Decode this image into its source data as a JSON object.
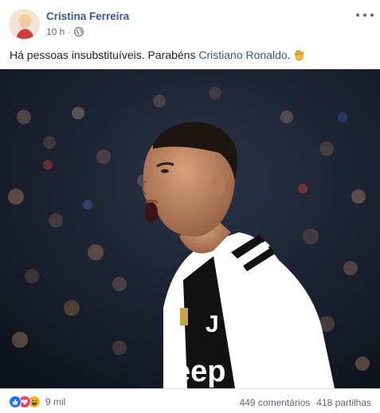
{
  "post": {
    "author": "Cristina Ferreira",
    "time": "10 h",
    "privacy_icon": "globe-icon",
    "text_before": "Há pessoas insubstituíveis. Parabéns ",
    "tagged_person": "Cristiano Ronaldo",
    "text_after": ".",
    "emoji": "clapping-hands-icon",
    "photo_icon": "soccer-player-celebrating-photo"
  },
  "footer": {
    "reaction_icons": [
      "like-icon",
      "love-icon",
      "haha-icon"
    ],
    "reaction_count": "9 mil",
    "comments": "449 comentários",
    "shares": "418 partilhas"
  },
  "colors": {
    "link": "#385898",
    "like": "#1877f2",
    "love": "#f33e58",
    "haha": "#f7b125",
    "kit_white": "#ffffff",
    "kit_black": "#111111"
  }
}
